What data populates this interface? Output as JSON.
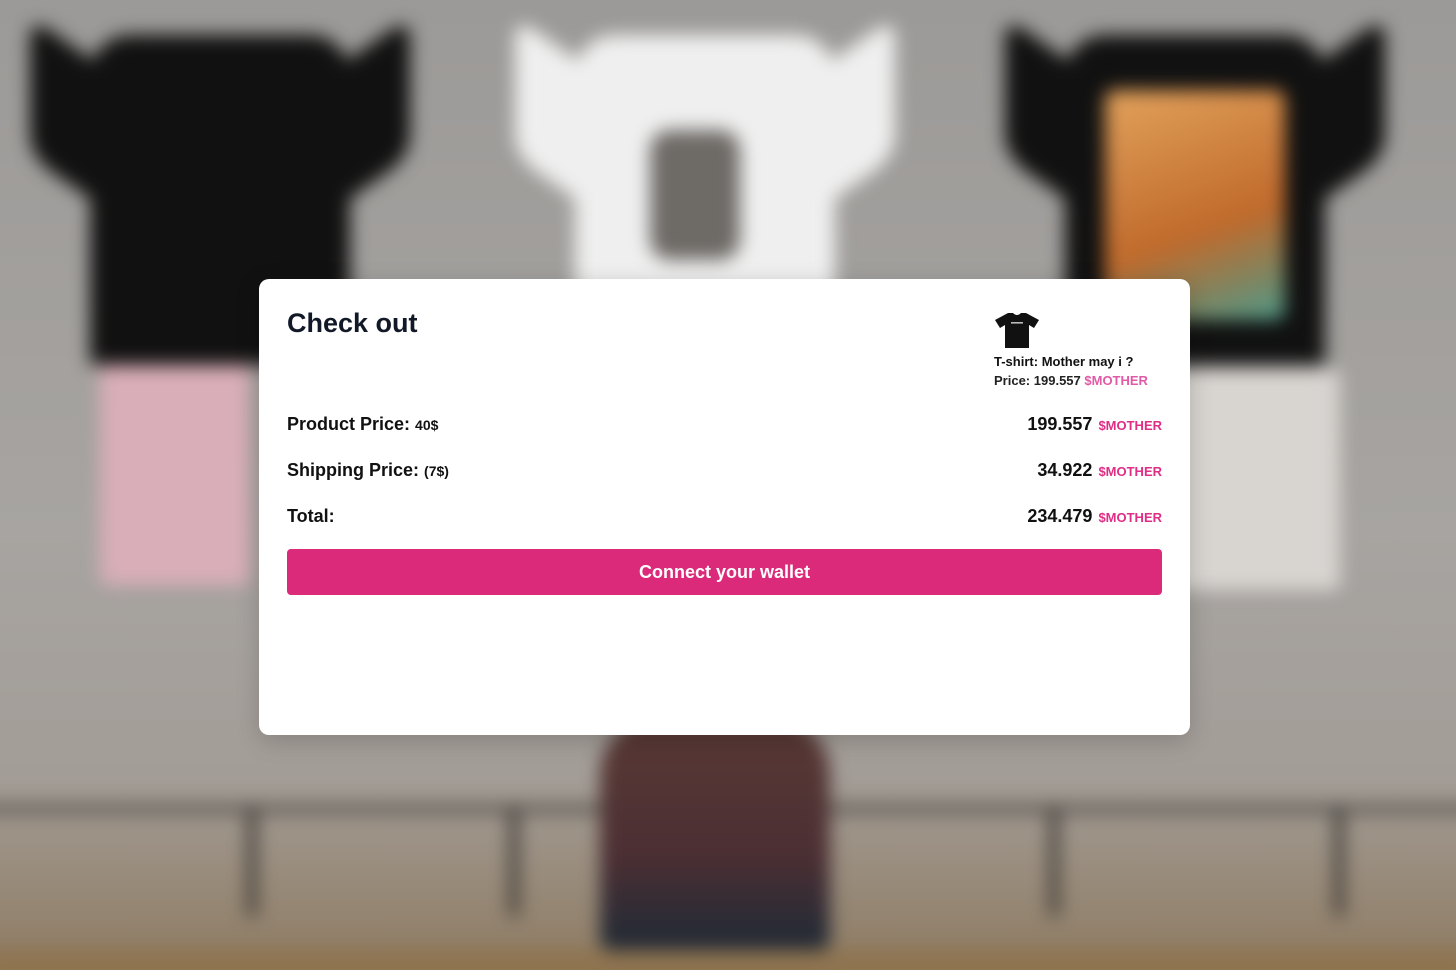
{
  "checkout": {
    "title": "Check out",
    "product": {
      "thumbnail_icon": "black-tshirt-icon",
      "name_label": "T-shirt:",
      "name": "Mother may i ?",
      "price_label": "Price:",
      "price": "199.557",
      "currency": "$MOTHER"
    },
    "rows": [
      {
        "label": "Product Price:",
        "note": "40$",
        "value": "199.557",
        "currency": "$MOTHER"
      },
      {
        "label": "Shipping Price:",
        "note": "(7$)",
        "value": "34.922",
        "currency": "$MOTHER"
      },
      {
        "label": "Total:",
        "note": "",
        "value": "234.479",
        "currency": "$MOTHER"
      }
    ],
    "button_label": "Connect your wallet"
  },
  "colors": {
    "accent": "#dc2a7a",
    "accent_text": "#e02d85",
    "accent_light": "#e05aa6",
    "modal_bg": "#ffffff"
  }
}
